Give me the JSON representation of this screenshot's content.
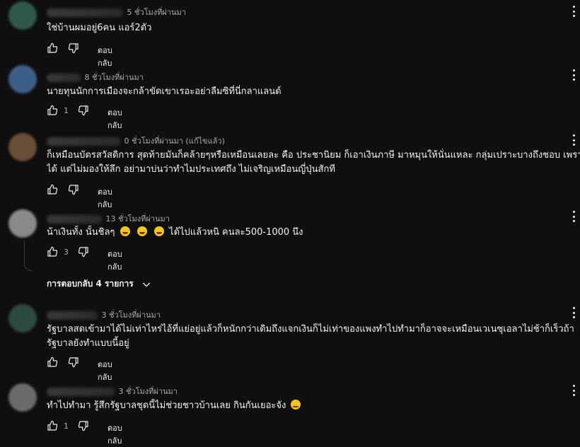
{
  "labels": {
    "reply": "ตอบกลับ",
    "replies_toggle": "การตอบกลับ 4 รายการ"
  },
  "comments": [
    {
      "time": "5 ชั่วโมงที่ผ่านมา",
      "text": "ใช่บ้านผมอยู่6คน แอร์2ตัว",
      "likes": "",
      "avatar_color": "#2f5a4a"
    },
    {
      "time": "8 ชั่วโมงที่ผ่านมา",
      "text": "นายทุนนักการเมืองจะกล้าขัดเขาเรอะอย่าลืมซิที่นี่กลาแลนด์",
      "likes": "1",
      "avatar_color": "#3c5f8a"
    },
    {
      "time": "0 ชั่วโมงที่ผ่านมา (แก้ไขแล้ว)",
      "text_line1": "ก็เหมือนบัตรสวัสดิการ สุดท้ายมันก็คล้ายๆหรือเหมือนเลยละ คือ ประชานิยม ก็เอาเงินภาษี มาหมุนให้นั่นแหละ กลุ่มเปราะบางถึงชอบ เพราะมีแ",
      "text_line2": "ได้ แต่ไม่มองให้ลึก อย่ามาบ่นว่าทำไมประเทศถึง ไม่เจริญเหมือนญี่ปุ่นสักที",
      "likes": "",
      "avatar_color": "#6a4e3a"
    },
    {
      "time": "13 ชั่วโมงที่ผ่านมา",
      "text_before": "น้าเงินทั้ง นั้นชิลๆ",
      "text_after": "ได้ไปแล้วหนิ คนละ500-1000 นึง",
      "likes": "3",
      "avatar_color": "#8a8a8a"
    },
    {
      "time": "3 ชั่วโมงที่ผ่านมา",
      "text_line1": "รัฐบาลสดเข้ามาได้ไม่เท่าไหร่ไอ้ที่แย่อยู่แล้วก็หนักกว่าเดิมถึงแจกเงินก็ไม่เท่าของแพงทำไปทำมาก็อาจจะเหมือนเวเนซุเอลาไม่ช้าก็เร็วถ้า",
      "text_line2": "รัฐบาลยังทำแบบนี้อยู่",
      "likes": "",
      "avatar_color": "#2e4a3e"
    },
    {
      "time": "3 ชั่วโมงที่ผ่านมา",
      "text": "ทำไปทำมา รู้สึกรัฐบาลชุดนี้ไม่ช่วยชาวบ้านเลย กินกันเยอะจัง",
      "likes": "1",
      "avatar_color": "#6b6b6b"
    }
  ]
}
